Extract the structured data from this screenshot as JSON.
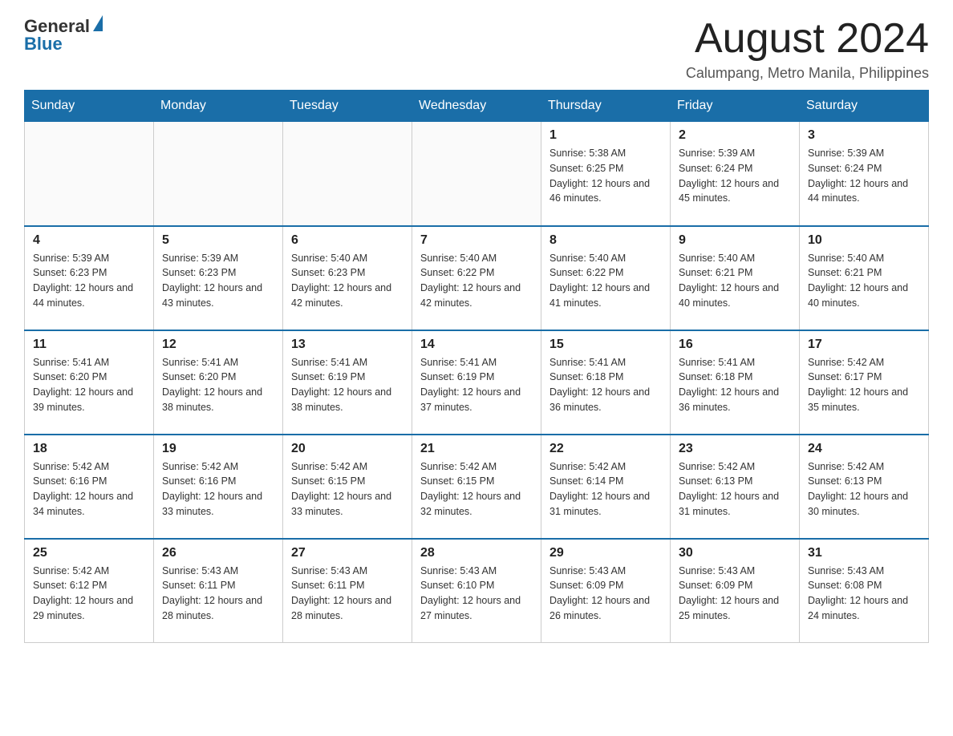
{
  "header": {
    "logo_general": "General",
    "logo_blue": "Blue",
    "month_year": "August 2024",
    "location": "Calumpang, Metro Manila, Philippines"
  },
  "days_of_week": [
    "Sunday",
    "Monday",
    "Tuesday",
    "Wednesday",
    "Thursday",
    "Friday",
    "Saturday"
  ],
  "weeks": [
    {
      "days": [
        {
          "number": "",
          "info": ""
        },
        {
          "number": "",
          "info": ""
        },
        {
          "number": "",
          "info": ""
        },
        {
          "number": "",
          "info": ""
        },
        {
          "number": "1",
          "info": "Sunrise: 5:38 AM\nSunset: 6:25 PM\nDaylight: 12 hours and 46 minutes."
        },
        {
          "number": "2",
          "info": "Sunrise: 5:39 AM\nSunset: 6:24 PM\nDaylight: 12 hours and 45 minutes."
        },
        {
          "number": "3",
          "info": "Sunrise: 5:39 AM\nSunset: 6:24 PM\nDaylight: 12 hours and 44 minutes."
        }
      ]
    },
    {
      "days": [
        {
          "number": "4",
          "info": "Sunrise: 5:39 AM\nSunset: 6:23 PM\nDaylight: 12 hours and 44 minutes."
        },
        {
          "number": "5",
          "info": "Sunrise: 5:39 AM\nSunset: 6:23 PM\nDaylight: 12 hours and 43 minutes."
        },
        {
          "number": "6",
          "info": "Sunrise: 5:40 AM\nSunset: 6:23 PM\nDaylight: 12 hours and 42 minutes."
        },
        {
          "number": "7",
          "info": "Sunrise: 5:40 AM\nSunset: 6:22 PM\nDaylight: 12 hours and 42 minutes."
        },
        {
          "number": "8",
          "info": "Sunrise: 5:40 AM\nSunset: 6:22 PM\nDaylight: 12 hours and 41 minutes."
        },
        {
          "number": "9",
          "info": "Sunrise: 5:40 AM\nSunset: 6:21 PM\nDaylight: 12 hours and 40 minutes."
        },
        {
          "number": "10",
          "info": "Sunrise: 5:40 AM\nSunset: 6:21 PM\nDaylight: 12 hours and 40 minutes."
        }
      ]
    },
    {
      "days": [
        {
          "number": "11",
          "info": "Sunrise: 5:41 AM\nSunset: 6:20 PM\nDaylight: 12 hours and 39 minutes."
        },
        {
          "number": "12",
          "info": "Sunrise: 5:41 AM\nSunset: 6:20 PM\nDaylight: 12 hours and 38 minutes."
        },
        {
          "number": "13",
          "info": "Sunrise: 5:41 AM\nSunset: 6:19 PM\nDaylight: 12 hours and 38 minutes."
        },
        {
          "number": "14",
          "info": "Sunrise: 5:41 AM\nSunset: 6:19 PM\nDaylight: 12 hours and 37 minutes."
        },
        {
          "number": "15",
          "info": "Sunrise: 5:41 AM\nSunset: 6:18 PM\nDaylight: 12 hours and 36 minutes."
        },
        {
          "number": "16",
          "info": "Sunrise: 5:41 AM\nSunset: 6:18 PM\nDaylight: 12 hours and 36 minutes."
        },
        {
          "number": "17",
          "info": "Sunrise: 5:42 AM\nSunset: 6:17 PM\nDaylight: 12 hours and 35 minutes."
        }
      ]
    },
    {
      "days": [
        {
          "number": "18",
          "info": "Sunrise: 5:42 AM\nSunset: 6:16 PM\nDaylight: 12 hours and 34 minutes."
        },
        {
          "number": "19",
          "info": "Sunrise: 5:42 AM\nSunset: 6:16 PM\nDaylight: 12 hours and 33 minutes."
        },
        {
          "number": "20",
          "info": "Sunrise: 5:42 AM\nSunset: 6:15 PM\nDaylight: 12 hours and 33 minutes."
        },
        {
          "number": "21",
          "info": "Sunrise: 5:42 AM\nSunset: 6:15 PM\nDaylight: 12 hours and 32 minutes."
        },
        {
          "number": "22",
          "info": "Sunrise: 5:42 AM\nSunset: 6:14 PM\nDaylight: 12 hours and 31 minutes."
        },
        {
          "number": "23",
          "info": "Sunrise: 5:42 AM\nSunset: 6:13 PM\nDaylight: 12 hours and 31 minutes."
        },
        {
          "number": "24",
          "info": "Sunrise: 5:42 AM\nSunset: 6:13 PM\nDaylight: 12 hours and 30 minutes."
        }
      ]
    },
    {
      "days": [
        {
          "number": "25",
          "info": "Sunrise: 5:42 AM\nSunset: 6:12 PM\nDaylight: 12 hours and 29 minutes."
        },
        {
          "number": "26",
          "info": "Sunrise: 5:43 AM\nSunset: 6:11 PM\nDaylight: 12 hours and 28 minutes."
        },
        {
          "number": "27",
          "info": "Sunrise: 5:43 AM\nSunset: 6:11 PM\nDaylight: 12 hours and 28 minutes."
        },
        {
          "number": "28",
          "info": "Sunrise: 5:43 AM\nSunset: 6:10 PM\nDaylight: 12 hours and 27 minutes."
        },
        {
          "number": "29",
          "info": "Sunrise: 5:43 AM\nSunset: 6:09 PM\nDaylight: 12 hours and 26 minutes."
        },
        {
          "number": "30",
          "info": "Sunrise: 5:43 AM\nSunset: 6:09 PM\nDaylight: 12 hours and 25 minutes."
        },
        {
          "number": "31",
          "info": "Sunrise: 5:43 AM\nSunset: 6:08 PM\nDaylight: 12 hours and 24 minutes."
        }
      ]
    }
  ]
}
